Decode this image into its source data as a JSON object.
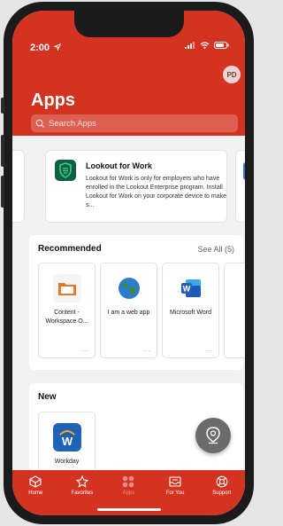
{
  "status": {
    "time": "2:00"
  },
  "header": {
    "avatar_initials": "PD",
    "title": "Apps",
    "search_placeholder": "Search Apps"
  },
  "featured": {
    "title": "Lookout for Work",
    "description": "Lookout for Work is only for employers who have enrolled in the Lookout Enterprise program. Install Lookout for Work on your corporate device to make s..."
  },
  "recommended": {
    "title": "Recommended",
    "see_all": "See All (5)",
    "apps": [
      {
        "name": "Content - Workspace O...",
        "icon": "folder-icon",
        "dots": "...",
        "color": "#e8772e"
      },
      {
        "name": "I am a web app",
        "icon": "globe-icon",
        "dots": "...",
        "color": "#3a8e3a"
      },
      {
        "name": "Microsoft Word",
        "icon": "word-icon",
        "dots": "...",
        "color": "#2b5fb4"
      }
    ]
  },
  "new": {
    "title": "New",
    "apps": [
      {
        "name": "Workday",
        "icon": "workday-icon",
        "color": "#1f63b6"
      }
    ]
  },
  "tabs": [
    {
      "label": "Home",
      "icon": "home-icon"
    },
    {
      "label": "Favorites",
      "icon": "star-icon"
    },
    {
      "label": "Apps",
      "icon": "grid-icon",
      "active": true
    },
    {
      "label": "For You",
      "icon": "inbox-icon"
    },
    {
      "label": "Support",
      "icon": "lifebuoy-icon"
    }
  ],
  "colors": {
    "brand": "#d43322"
  }
}
